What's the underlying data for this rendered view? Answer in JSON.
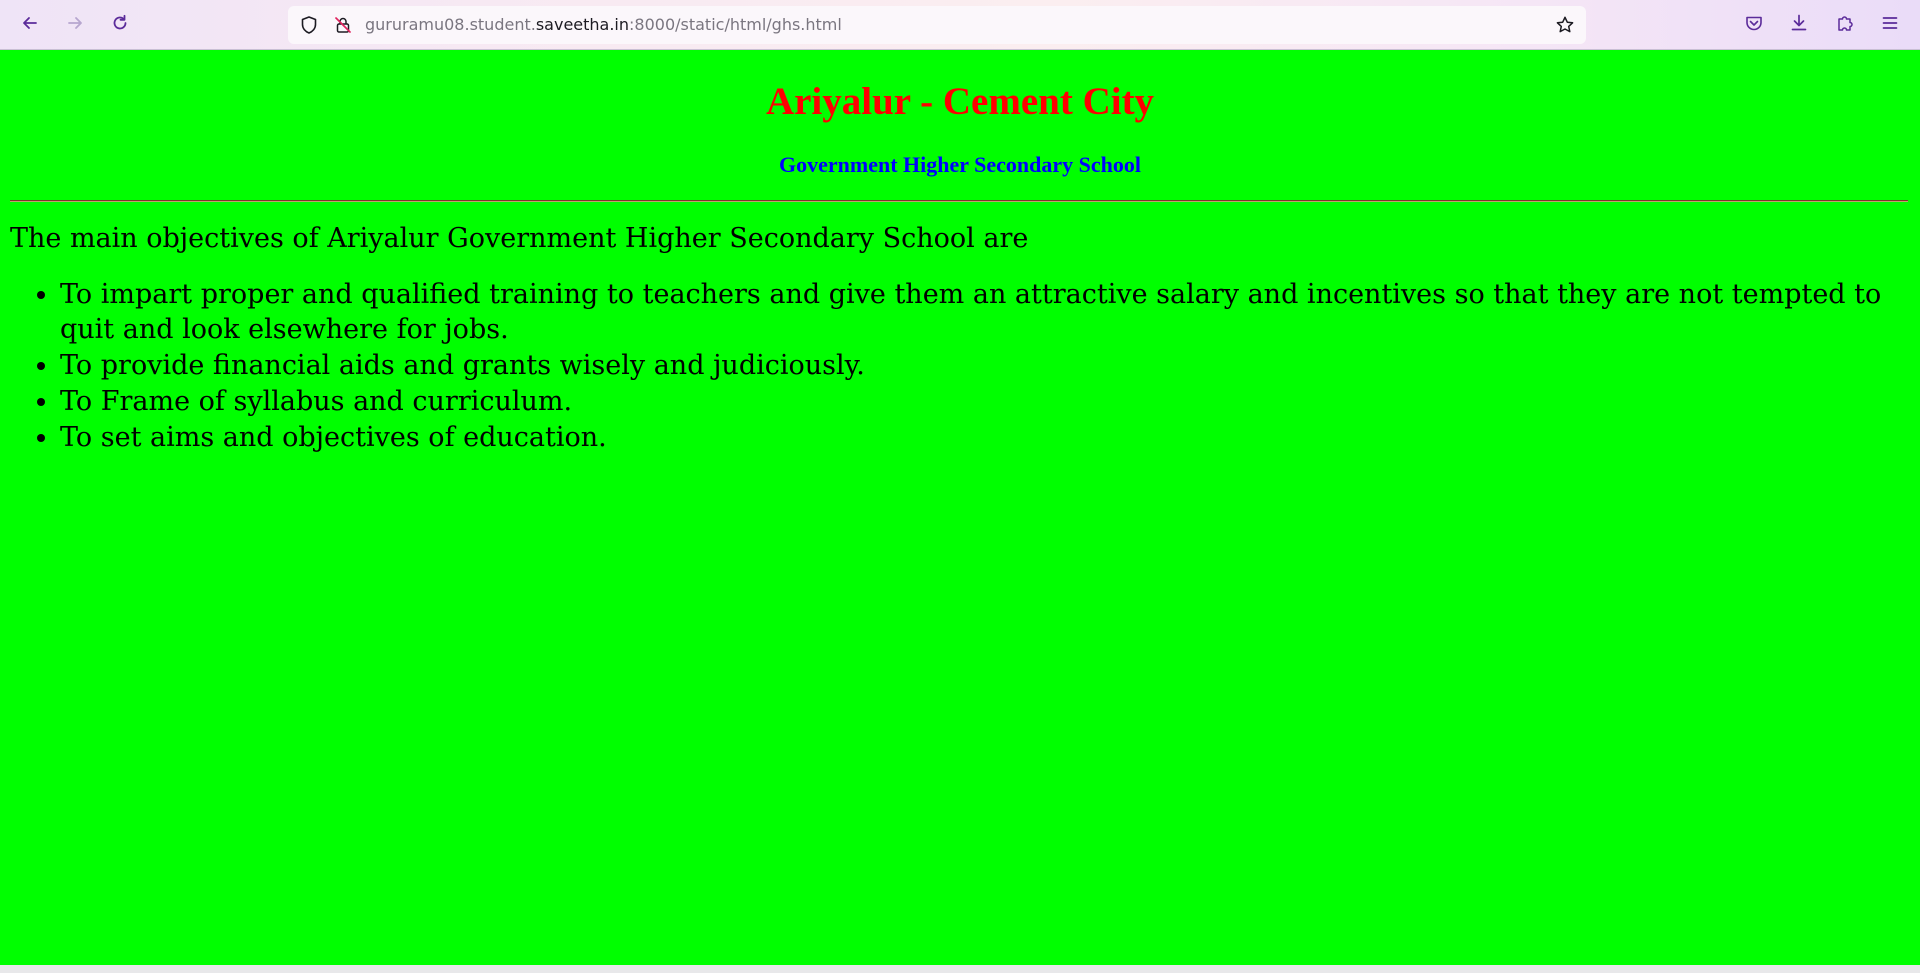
{
  "browser": {
    "url_prefix": "gururamu08.student.",
    "url_host": "saveetha.in",
    "url_suffix": ":8000/static/html/ghs.html",
    "icons": {
      "back": "arrow-left-icon",
      "forward": "arrow-right-icon",
      "reload": "reload-icon",
      "shield": "shield-icon",
      "not_secure": "not-secure-lock-icon",
      "bookmark": "star-icon",
      "pocket": "pocket-icon",
      "downloads": "download-icon",
      "extensions": "puzzle-icon",
      "menu": "hamburger-menu-icon"
    }
  },
  "page": {
    "background": "#00ff00",
    "title": "Ariyalur - Cement City",
    "title_color": "#ff0000",
    "subtitle": "Government Higher Secondary School",
    "subtitle_color": "#0000ff",
    "intro": "The main objectives of Ariyalur Government Higher Secondary School are",
    "objectives": [
      "To impart proper and qualified training to teachers and give them an attractive salary and incentives so that they are not tempted to quit and look elsewhere for jobs.",
      "To provide financial aids and grants wisely and judiciously.",
      "To Frame of syllabus and curriculum.",
      "To set aims and objectives of education."
    ]
  }
}
